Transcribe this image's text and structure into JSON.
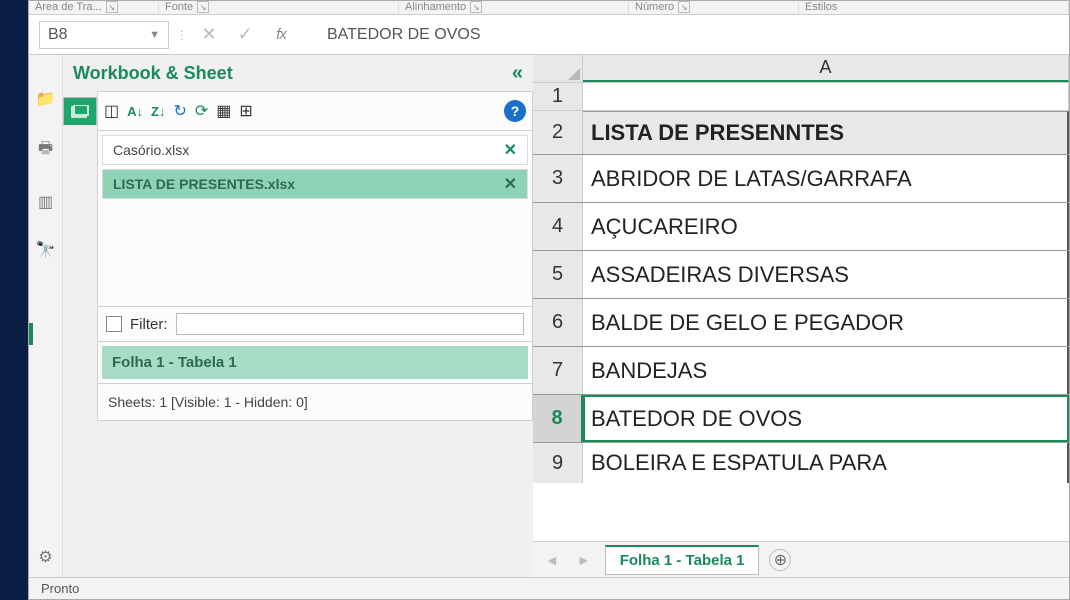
{
  "ribbon": {
    "groups": [
      "Área de Tra...",
      "Fonte",
      "Alinhamento",
      "Número",
      "Estilos"
    ]
  },
  "namebox": {
    "ref": "B8"
  },
  "formula_bar": {
    "value": "BATEDOR DE OVOS"
  },
  "panel": {
    "title": "Workbook & Sheet",
    "workbooks": [
      {
        "name": "Casório.xlsx",
        "active": false
      },
      {
        "name": "LISTA DE PRESENTES.xlsx",
        "active": true
      }
    ],
    "filter_label": "Filter:",
    "active_sheet": "Folha 1 - Tabela 1",
    "stats": "Sheets: 1  [Visible: 1 - Hidden: 0]"
  },
  "grid": {
    "columns": [
      "A"
    ],
    "rows": [
      {
        "num": "1",
        "A": ""
      },
      {
        "num": "2",
        "A": "LISTA DE PRESENNTES",
        "header": true
      },
      {
        "num": "3",
        "A": "ABRIDOR DE LATAS/GARRAFA"
      },
      {
        "num": "4",
        "A": "AÇUCAREIRO"
      },
      {
        "num": "5",
        "A": "ASSADEIRAS DIVERSAS"
      },
      {
        "num": "6",
        "A": "BALDE DE GELO E PEGADOR"
      },
      {
        "num": "7",
        "A": "BANDEJAS"
      },
      {
        "num": "8",
        "A": "BATEDOR DE OVOS",
        "selected": true
      },
      {
        "num": "9",
        "A": "BOLEIRA  E ESPATULA PARA "
      }
    ],
    "active_tab": "Folha 1 - Tabela 1"
  },
  "status": "Pronto"
}
